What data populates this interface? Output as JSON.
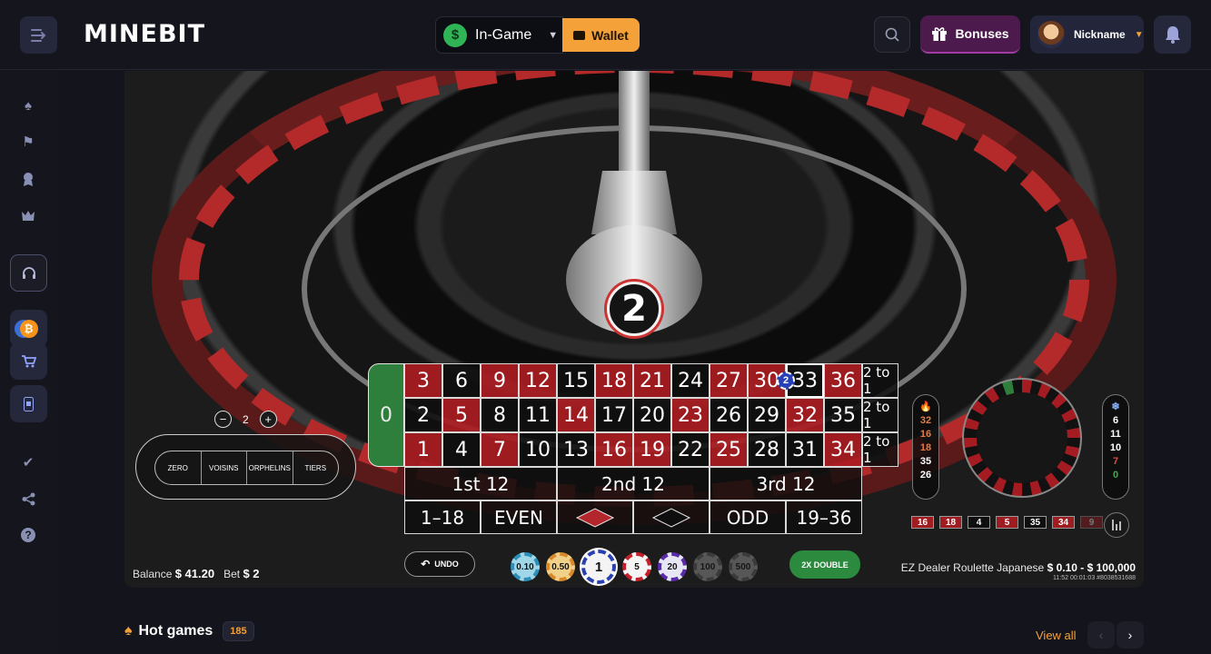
{
  "header": {
    "logo": "MINEBIT",
    "currency": {
      "label": "In-Game",
      "symbol": "$"
    },
    "wallet_label": "Wallet",
    "bonuses_label": "Bonuses",
    "user": {
      "nickname": "Nickname"
    }
  },
  "game": {
    "result": "2",
    "table": {
      "zero": "0",
      "rows": [
        [
          "3",
          "6",
          "9",
          "12",
          "15",
          "18",
          "21",
          "24",
          "27",
          "30",
          "33",
          "36"
        ],
        [
          "2",
          "5",
          "8",
          "11",
          "14",
          "17",
          "20",
          "23",
          "26",
          "29",
          "32",
          "35"
        ],
        [
          "1",
          "4",
          "7",
          "10",
          "13",
          "16",
          "19",
          "22",
          "25",
          "28",
          "31",
          "34"
        ]
      ],
      "red_numbers": [
        "1",
        "3",
        "5",
        "7",
        "9",
        "12",
        "14",
        "16",
        "18",
        "19",
        "21",
        "23",
        "25",
        "27",
        "30",
        "32",
        "34",
        "36"
      ],
      "column_label": "2 to 1",
      "dozens": [
        "1st 12",
        "2nd 12",
        "3rd 12"
      ],
      "outside": [
        "1–18",
        "EVEN",
        "",
        "",
        "ODD",
        "19–36"
      ],
      "placed_chip": "2"
    },
    "racetrack": {
      "sections": [
        "ZERO",
        "VOISINS",
        "ORPHELINS",
        "TIERS"
      ],
      "neighbours": "2"
    },
    "hot_numbers": [
      "32",
      "16",
      "18",
      "35",
      "26"
    ],
    "cold_numbers": [
      "6",
      "11",
      "10",
      "7",
      "0"
    ],
    "recent_results": [
      "16",
      "18",
      "4",
      "5",
      "35",
      "34",
      "9"
    ],
    "balance_label": "Balance",
    "balance": "$ 41.20",
    "bet_label": "Bet",
    "bet": "$ 2",
    "undo_label": "UNDO",
    "chips": [
      "0.10",
      "0.50",
      "1",
      "5",
      "20",
      "100",
      "500"
    ],
    "double_label": "2X DOUBLE",
    "title": "EZ Dealer Roulette Japanese",
    "limits": "$ 0.10 - $ 100,000",
    "meta": "11:52  00:01:03  #8038531688"
  },
  "hot_games": {
    "title": "Hot games",
    "count": "185",
    "view_all": "View all"
  },
  "colors": {
    "accent": "#f4a13a",
    "red": "#aa1c22",
    "green": "#2f7f3c"
  }
}
